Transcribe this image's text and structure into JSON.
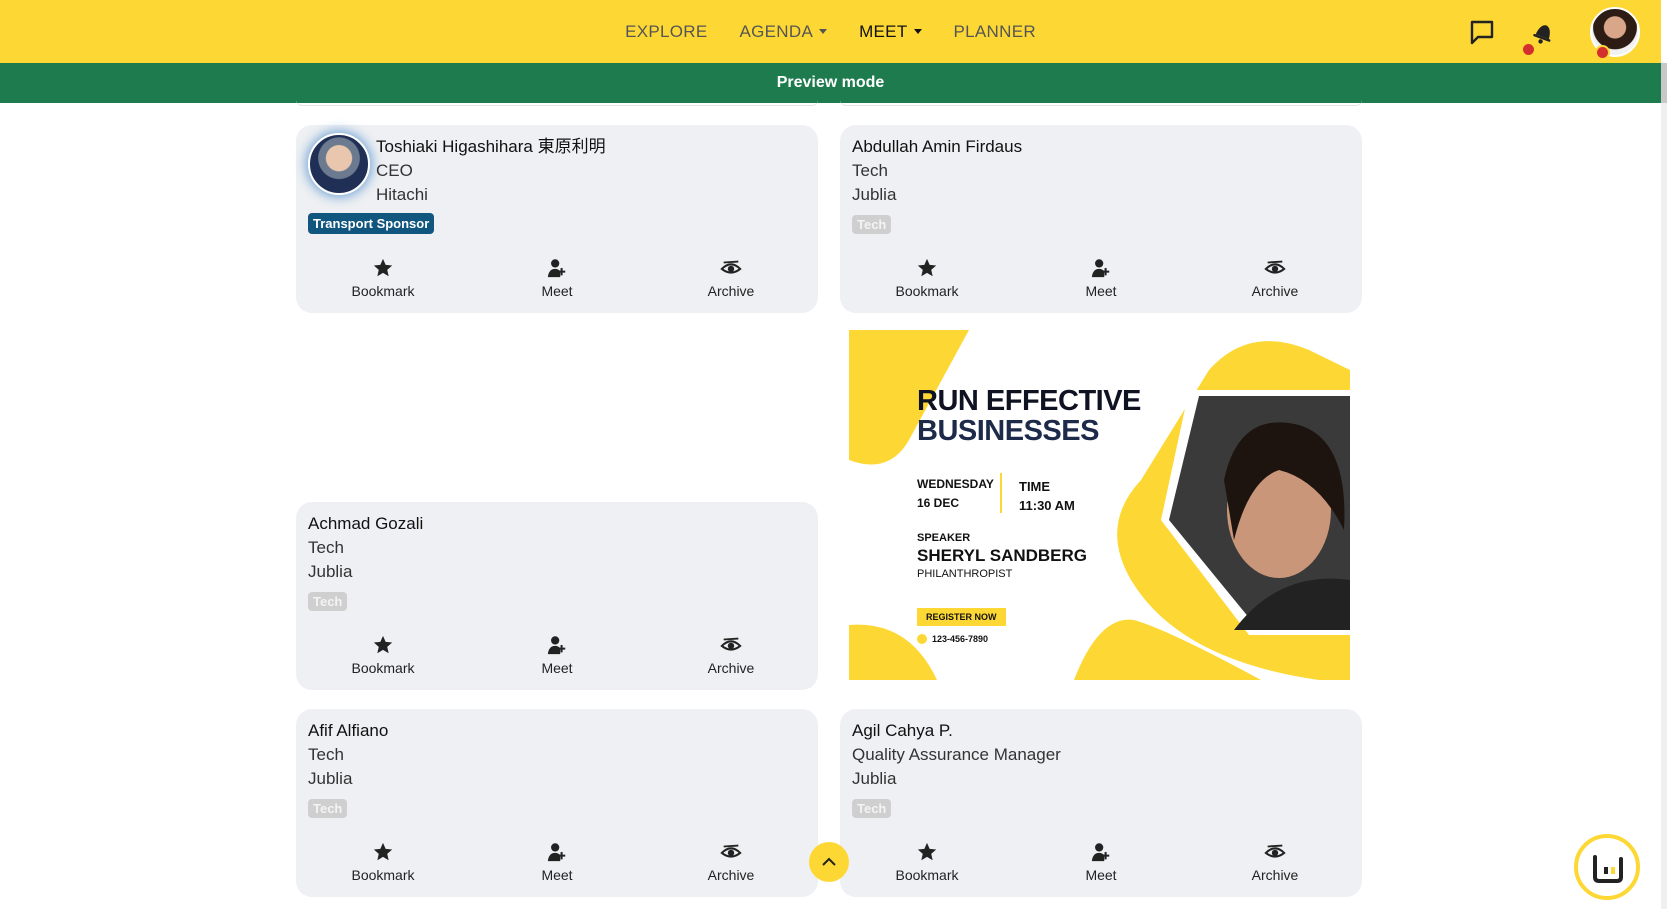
{
  "nav": {
    "items": [
      {
        "label": "EXPLORE",
        "dropdown": false,
        "active": false
      },
      {
        "label": "AGENDA",
        "dropdown": true,
        "active": false
      },
      {
        "label": "MEET",
        "dropdown": true,
        "active": true
      },
      {
        "label": "PLANNER",
        "dropdown": false,
        "active": false
      }
    ]
  },
  "preview_label": "Preview mode",
  "colors": {
    "accent": "#fdd835",
    "preview": "#1e7b4d",
    "sponsor_tag": "#11567f",
    "notification": "#d32f2f"
  },
  "actions": {
    "bookmark": "Bookmark",
    "meet": "Meet",
    "archive": "Archive"
  },
  "cards": [
    {
      "name": "Toshiaki Higashihara 東原利明",
      "title": "CEO",
      "company": "Hitachi",
      "tag": "Transport Sponsor",
      "has_photo": true
    },
    {
      "name": "Abdullah Amin Firdaus",
      "title": "Tech",
      "company": "Jublia",
      "tag": "Tech",
      "has_photo": false
    },
    {
      "name": "Achmad Gozali",
      "title": "Tech",
      "company": "Jublia",
      "tag": "Tech",
      "has_photo": false
    },
    {
      "name": "Afif Alfiano",
      "title": "Tech",
      "company": "Jublia",
      "tag": "Tech",
      "has_photo": false
    },
    {
      "name": "Agil Cahya P.",
      "title": "Quality Assurance Manager",
      "company": "Jublia",
      "tag": "Tech",
      "has_photo": false
    }
  ],
  "banner": {
    "title_line1": "RUN EFFECTIVE",
    "title_line2": "BUSINESSES",
    "day": "WEDNESDAY",
    "date": "16 DEC",
    "time_label": "TIME",
    "time": "11:30 AM",
    "speaker_label": "SPEAKER",
    "speaker": "SHERYL SANDBERG",
    "role": "PHILANTHROPIST",
    "register": "REGISTER NOW",
    "phone": "123-456-7890"
  }
}
